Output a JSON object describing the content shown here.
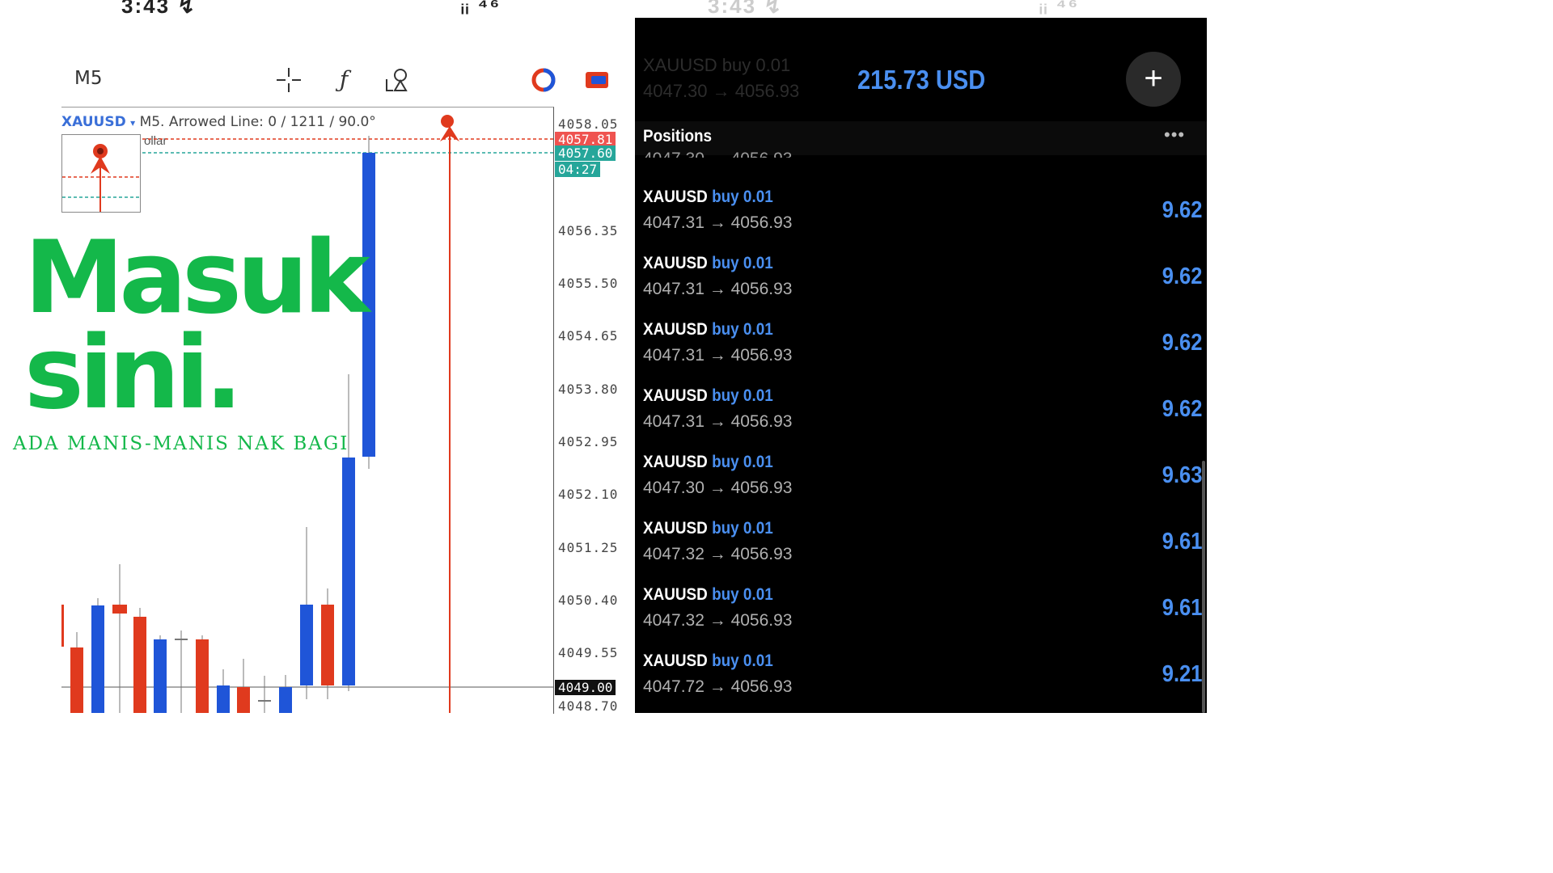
{
  "left_panel": {
    "status_time": "3:43 ↯",
    "status_right": "ᵢᵢ ⁴⁶",
    "timeframe": "M5",
    "chart_header": {
      "symbol": "XAUUSD",
      "caret": "▾",
      "info": "M5. Arrowed Line: 0 / 1211 / 90.0°",
      "sub": "ollar"
    },
    "axis_labels": [
      "4058.05",
      "4056.35",
      "4055.50",
      "4054.65",
      "4053.80",
      "4052.95",
      "4052.10",
      "4051.25",
      "4050.40",
      "4049.55",
      "4048.70"
    ],
    "price_tags": {
      "ask": "4057.81",
      "bid": "4057.60",
      "timer": "04:27",
      "line": "4049.00"
    },
    "colors": {
      "bull": "#1f55d8",
      "bear": "#e03a1e",
      "ask_tag": "#ef5350",
      "bid_tag": "#26a69a",
      "arrow": "#e03a1e"
    },
    "tools": [
      "crosshair-icon",
      "function-icon",
      "object-icon",
      "indicator-ring-icon",
      "trade-icon"
    ]
  },
  "promo": {
    "title_line1": "Masuk",
    "title_line2": "sini.",
    "tagline": "ADA MANIS-MANIS NAK BAGI",
    "color": "#14b84a"
  },
  "right_panel": {
    "status_time": "3:43 ↯",
    "status_right": "ᵢᵢ ⁴⁶",
    "ghost_sym": "XAUUSD buy 0.01",
    "ghost_prices": "4047.30 → 4056.93",
    "balance": "215.73 USD",
    "add_button": "+",
    "section_title": "Positions",
    "more": "•••",
    "partial_row": "4047.30 → 4056.93",
    "positions": [
      {
        "symbol": "XAUUSD",
        "side": "buy 0.01",
        "prices": "4047.31 → 4056.93",
        "profit": "9.62"
      },
      {
        "symbol": "XAUUSD",
        "side": "buy 0.01",
        "prices": "4047.31 → 4056.93",
        "profit": "9.62"
      },
      {
        "symbol": "XAUUSD",
        "side": "buy 0.01",
        "prices": "4047.31 → 4056.93",
        "profit": "9.62"
      },
      {
        "symbol": "XAUUSD",
        "side": "buy 0.01",
        "prices": "4047.31 → 4056.93",
        "profit": "9.62"
      },
      {
        "symbol": "XAUUSD",
        "side": "buy 0.01",
        "prices": "4047.30 → 4056.93",
        "profit": "9.63"
      },
      {
        "symbol": "XAUUSD",
        "side": "buy 0.01",
        "prices": "4047.32 → 4056.93",
        "profit": "9.61"
      },
      {
        "symbol": "XAUUSD",
        "side": "buy 0.01",
        "prices": "4047.32 → 4056.93",
        "profit": "9.61"
      },
      {
        "symbol": "XAUUSD",
        "side": "buy 0.01",
        "prices": "4047.72 → 4056.93",
        "profit": "9.21"
      }
    ],
    "colors": {
      "accent": "#4a8ff0",
      "background": "#000000"
    }
  }
}
